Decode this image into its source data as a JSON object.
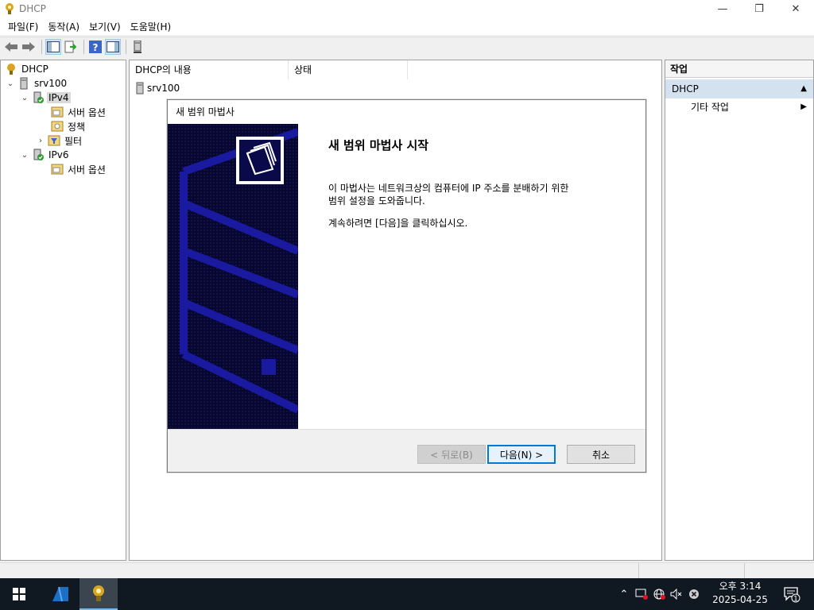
{
  "window": {
    "title": "DHCP"
  },
  "menu": [
    "파일(F)",
    "동작(A)",
    "보기(V)",
    "도움말(H)"
  ],
  "toolbar": {
    "icons": [
      "back-icon",
      "forward-icon",
      "show-hide-console-tree-icon",
      "export-list-icon",
      "help-icon",
      "show-hide-action-pane-icon",
      "server-icon"
    ]
  },
  "tree": {
    "root": "DHCP",
    "server": "srv100",
    "ipv4": "IPv4",
    "ipv4_children": [
      "서버 옵션",
      "정책",
      "필터"
    ],
    "ipv6": "IPv6",
    "ipv6_children": [
      "서버 옵션"
    ]
  },
  "center": {
    "columns": [
      "DHCP의 내용",
      "상태"
    ],
    "rows": [
      "srv100"
    ]
  },
  "actions": {
    "header": "작업",
    "section": "DHCP",
    "items": [
      "기타 작업"
    ]
  },
  "wizard": {
    "title": "새 범위 마법사",
    "heading": "새 범위 마법사 시작",
    "para1": "이 마법사는 네트워크상의 컴퓨터에 IP 주소를 분배하기 위한\n범위 설정을 도와줍니다.",
    "para2": "계속하려면 [다음]을 클릭하십시오.",
    "back_label": "< 뒤로(B)",
    "next_label": "다음(N) >",
    "cancel_label": "취소"
  },
  "taskbar": {
    "time": "오후 3:14",
    "date": "2025-04-25",
    "notification_count": "1"
  },
  "colors": {
    "banner": "#0a0a4a",
    "banner_lines": "#1a1aa0",
    "selection": "#d4e2f0",
    "accent": "#0078d7",
    "taskbar": "#101821"
  }
}
